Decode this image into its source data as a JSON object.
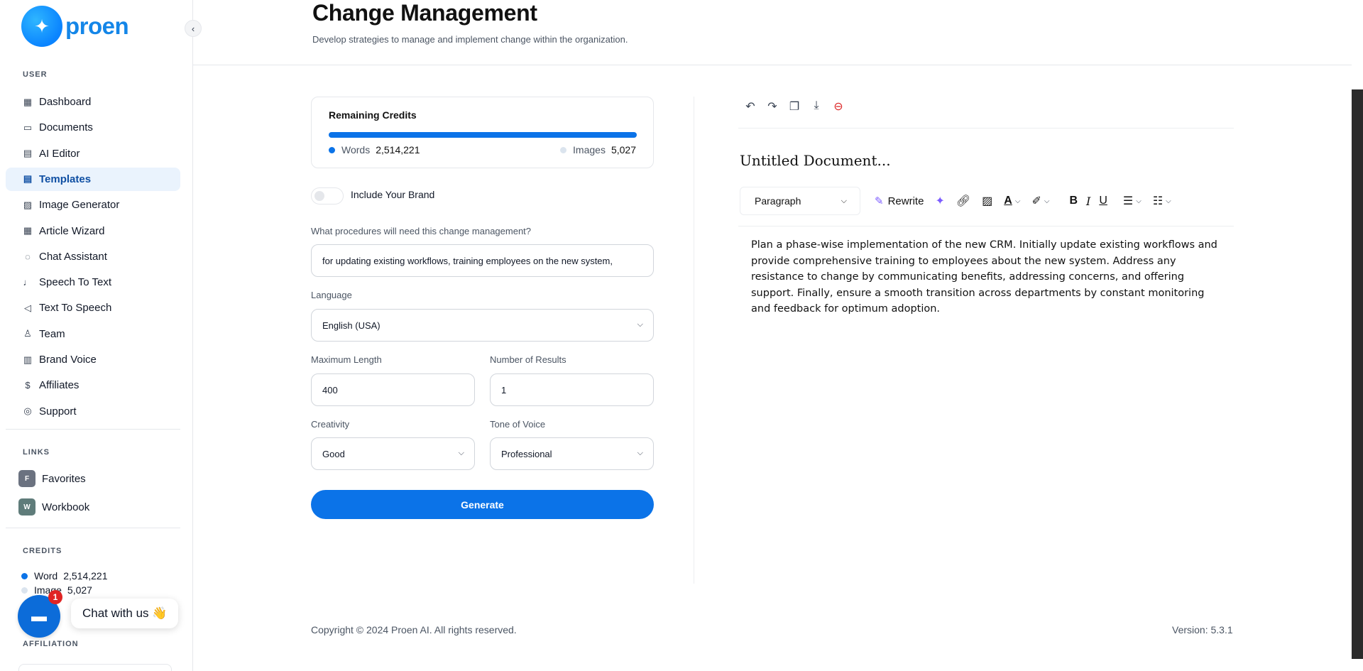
{
  "brand": {
    "name": "proen",
    "logo_glyph": "✦"
  },
  "sidebar": {
    "user_section": "USER",
    "items": [
      {
        "label": "Dashboard",
        "icon": "▦",
        "icon_name": "dashboard-icon"
      },
      {
        "label": "Documents",
        "icon": "▭",
        "icon_name": "archive-icon"
      },
      {
        "label": "AI Editor",
        "icon": "▤",
        "icon_name": "editor-icon"
      },
      {
        "label": "Templates",
        "icon": "▤",
        "icon_name": "template-icon",
        "active": true
      },
      {
        "label": "Image Generator",
        "icon": "▨",
        "icon_name": "image-icon"
      },
      {
        "label": "Article Wizard",
        "icon": "▦",
        "icon_name": "article-icon"
      },
      {
        "label": "Chat Assistant",
        "icon": "◌",
        "icon_name": "chat-icon"
      },
      {
        "label": "Speech To Text",
        "icon": "♩",
        "icon_name": "microphone-icon"
      },
      {
        "label": "Text To Speech",
        "icon": "◁",
        "icon_name": "speaker-icon"
      },
      {
        "label": "Team",
        "icon": "♙",
        "icon_name": "team-icon"
      },
      {
        "label": "Brand Voice",
        "icon": "▥",
        "icon_name": "brand-voice-icon"
      },
      {
        "label": "Affiliates",
        "icon": "$",
        "icon_name": "dollar-icon"
      },
      {
        "label": "Support",
        "icon": "◎",
        "icon_name": "support-icon"
      }
    ],
    "links_section": "LINKS",
    "links": [
      {
        "badge": "F",
        "label": "Favorites",
        "color": "#6b7280"
      },
      {
        "badge": "W",
        "label": "Workbook",
        "color": "#5f7c7a"
      }
    ],
    "credits_section": "CREDITS",
    "credits": {
      "word_label": "Word",
      "word_value": "2,514,221",
      "word_color": "#0b73e8",
      "image_label": "Image",
      "image_value": "5,027",
      "image_color": "#dbe4ee"
    },
    "affiliation_section": "AFFILIATION"
  },
  "chat_widget": {
    "badge": "1",
    "label": "Chat with us 👋"
  },
  "header": {
    "title": "Change Management",
    "subtitle": "Develop strategies to manage and implement change within the organization."
  },
  "form": {
    "credits_card": {
      "title": "Remaining Credits",
      "words_label": "Words",
      "words_value": "2,514,221",
      "images_label": "Images",
      "images_value": "5,027",
      "words_fraction": 1.0
    },
    "include_brand_label": "Include Your Brand",
    "include_brand_on": false,
    "procedures_label": "What procedures will need this change management?",
    "procedures_value": "for updating existing workflows, training employees on the new system,",
    "language_label": "Language",
    "language_value": "English (USA)",
    "max_length_label": "Maximum Length",
    "max_length_value": "400",
    "num_results_label": "Number of Results",
    "num_results_value": "1",
    "creativity_label": "Creativity",
    "creativity_value": "Good",
    "tone_label": "Tone of Voice",
    "tone_value": "Professional",
    "generate_label": "Generate"
  },
  "editor": {
    "doc_title": "Untitled Document...",
    "paragraph_select": "Paragraph",
    "rewrite_label": "Rewrite",
    "content": "Plan a phase-wise implementation of the new CRM. Initially update existing workflows and provide comprehensive training to employees about the new system. Address any resistance to change by communicating benefits, addressing concerns, and offering support. Finally, ensure a smooth transition across departments by constant monitoring and feedback for optimum adoption."
  },
  "footer": {
    "copyright": "Copyright © 2024 Proen AI. All rights reserved.",
    "version": "Version: 5.3.1"
  },
  "colors": {
    "accent": "#0b73e8",
    "active_bg": "#eaf3fd",
    "danger": "#dc2626"
  }
}
